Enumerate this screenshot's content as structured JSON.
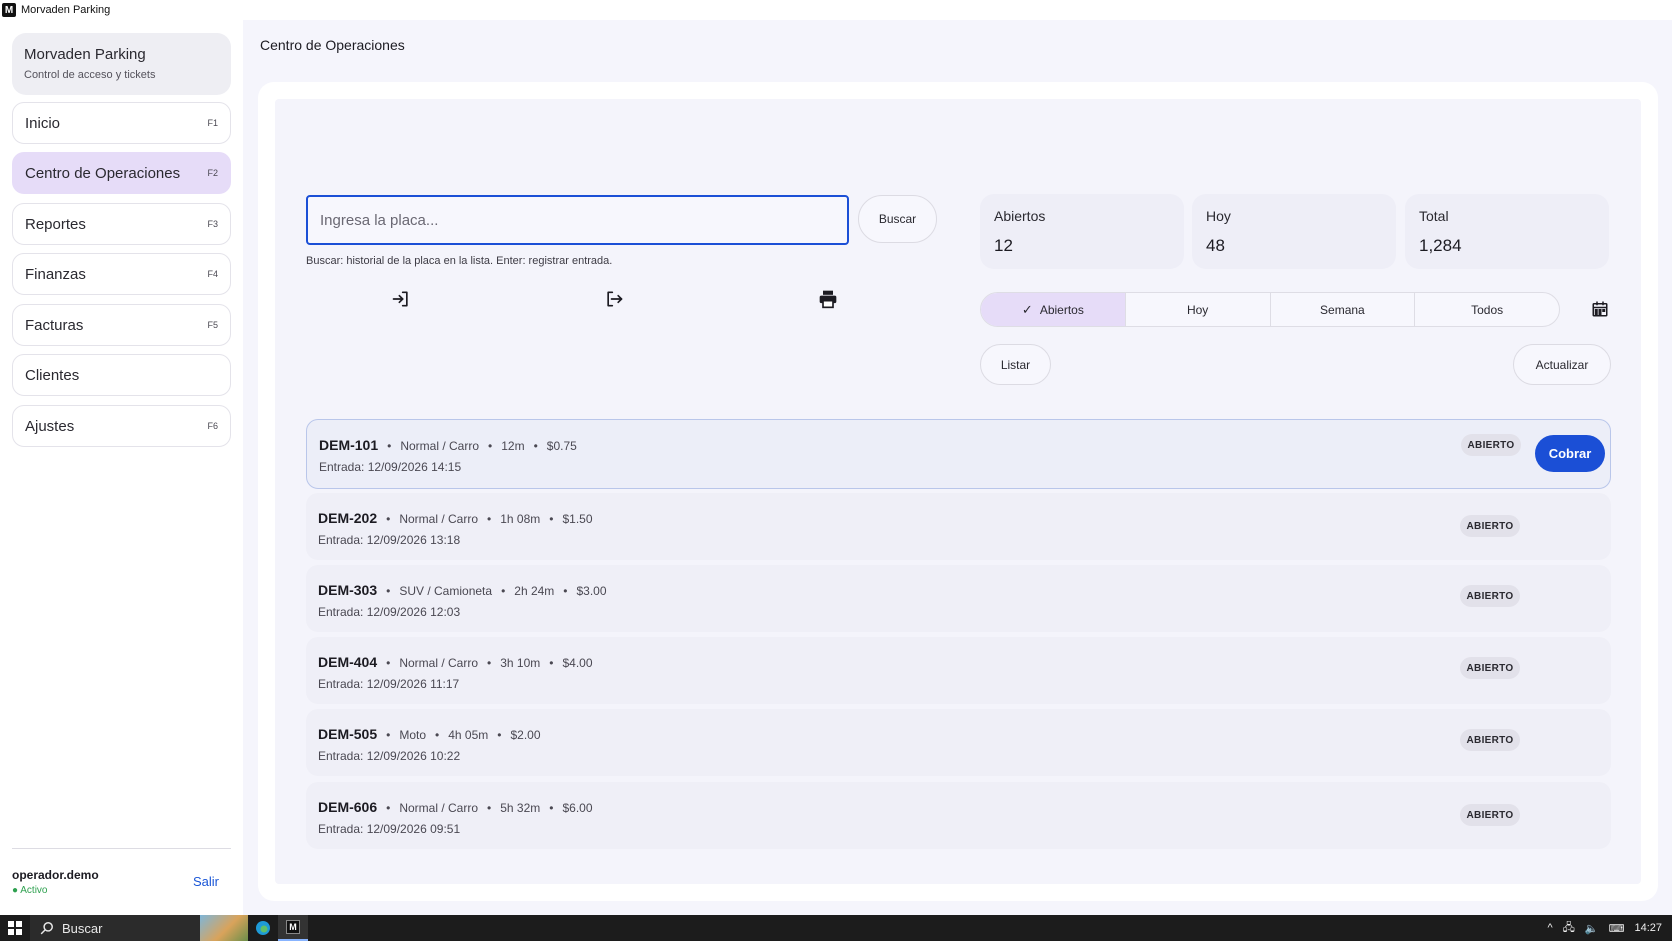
{
  "window": {
    "title": "Morvaden Parking",
    "icon_letter": "M"
  },
  "sidebar": {
    "brand_name": "Morvaden Parking",
    "brand_subtitle": "Control de acceso y tickets",
    "items": [
      {
        "label": "Inicio",
        "key": "F1"
      },
      {
        "label": "Centro de Operaciones",
        "key": "F2"
      },
      {
        "label": "Reportes",
        "key": "F3"
      },
      {
        "label": "Finanzas",
        "key": "F4"
      },
      {
        "label": "Facturas",
        "key": "F5"
      },
      {
        "label": "Clientes",
        "key": ""
      },
      {
        "label": "Ajustes",
        "key": "F6"
      }
    ],
    "user_name": "operador.demo",
    "user_status": "● Activo",
    "logout_label": "Salir"
  },
  "main": {
    "page_title": "Centro de Operaciones",
    "search": {
      "placeholder": "Ingresa la placa...",
      "value": "",
      "button_label": "Buscar",
      "hint": "Buscar: historial de la placa en la lista. Enter: registrar entrada."
    },
    "actions": {
      "entry_icon": "login-icon",
      "exit_icon": "logout-icon",
      "print_icon": "printer-icon"
    },
    "stats": [
      {
        "label": "Abiertos",
        "value": "12"
      },
      {
        "label": "Hoy",
        "value": "48"
      },
      {
        "label": "Total",
        "value": "1,284"
      }
    ],
    "filters": [
      "Abiertos",
      "Hoy",
      "Semana",
      "Todos"
    ],
    "active_filter": "Abiertos",
    "list_button": "Listar",
    "refresh_button": "Actualizar",
    "tickets": [
      {
        "plate": "DEM-101",
        "type": "Normal / Carro",
        "duration": "12m",
        "amount": "$0.75",
        "entry": "Entrada: 12/09/2026 14:15",
        "status": "ABIERTO",
        "action": "Cobrar"
      },
      {
        "plate": "DEM-202",
        "type": "Normal / Carro",
        "duration": "1h 08m",
        "amount": "$1.50",
        "entry": "Entrada: 12/09/2026 13:18",
        "status": "ABIERTO"
      },
      {
        "plate": "DEM-303",
        "type": "SUV / Camioneta",
        "duration": "2h 24m",
        "amount": "$3.00",
        "entry": "Entrada: 12/09/2026 12:03",
        "status": "ABIERTO"
      },
      {
        "plate": "DEM-404",
        "type": "Normal / Carro",
        "duration": "3h 10m",
        "amount": "$4.00",
        "entry": "Entrada: 12/09/2026 11:17",
        "status": "ABIERTO"
      },
      {
        "plate": "DEM-505",
        "type": "Moto",
        "duration": "4h 05m",
        "amount": "$2.00",
        "entry": "Entrada: 12/09/2026 10:22",
        "status": "ABIERTO"
      },
      {
        "plate": "DEM-606",
        "type": "Normal / Carro",
        "duration": "5h 32m",
        "amount": "$6.00",
        "entry": "Entrada: 12/09/2026 09:51",
        "status": "ABIERTO"
      }
    ]
  },
  "taskbar": {
    "search_label": "Buscar",
    "time": "14:27"
  },
  "colors": {
    "accent": "#1b4fd6",
    "active_nav": "#e6dcf8",
    "status_green": "#2ea04f"
  }
}
